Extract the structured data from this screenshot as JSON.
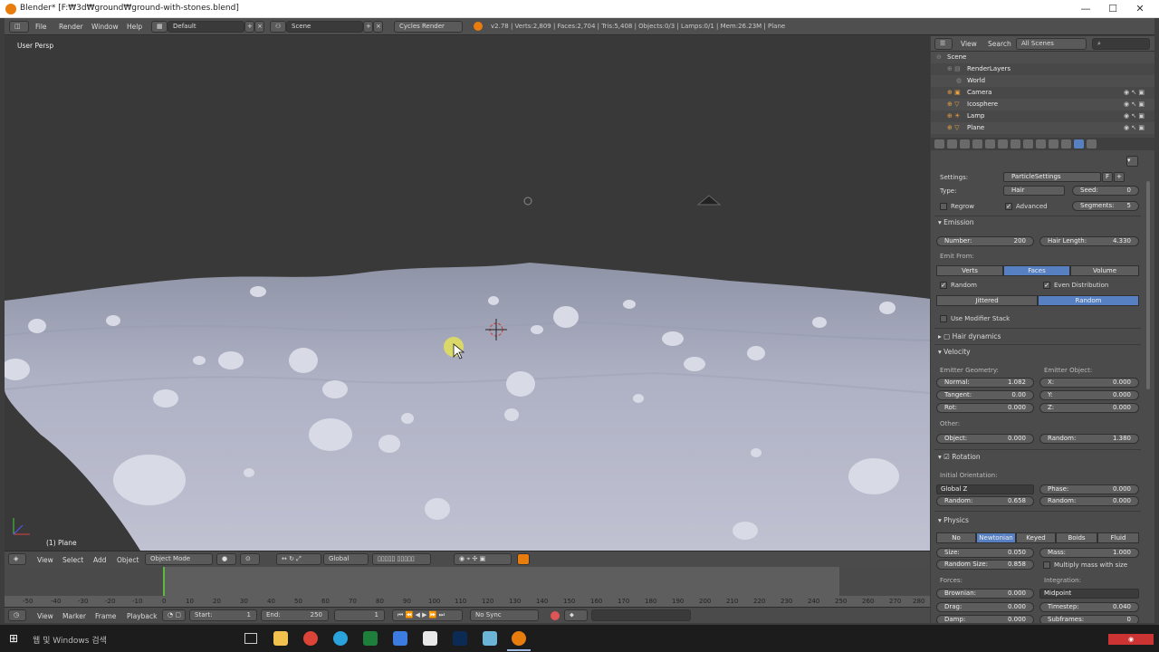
{
  "window": {
    "title": "Blender* [F:₩3d₩ground₩ground-with-stones.blend]",
    "min": "—",
    "max": "☐",
    "close": "✕"
  },
  "menubar": {
    "menus": [
      "File",
      "Render",
      "Window",
      "Help"
    ],
    "layout": "Default",
    "scene": "Scene",
    "engine": "Cycles Render",
    "stats": "v2.78 | Verts:2,809 | Faces:2,704 | Tris:5,408 | Objects:0/3 | Lamps:0/1 | Mem:26.23M | Plane"
  },
  "viewport": {
    "persp_label": "User Persp",
    "object_label": "(1) Plane",
    "header": {
      "menus": [
        "View",
        "Select",
        "Add",
        "Object"
      ],
      "mode": "Object Mode",
      "orientation": "Global"
    }
  },
  "timeline": {
    "ticks": [
      "-50",
      "-40",
      "-30",
      "-20",
      "-10",
      "0",
      "10",
      "20",
      "30",
      "40",
      "50",
      "60",
      "70",
      "80",
      "90",
      "100",
      "110",
      "120",
      "130",
      "140",
      "150",
      "160",
      "170",
      "180",
      "190",
      "200",
      "210",
      "220",
      "230",
      "240",
      "250",
      "260",
      "270",
      "280"
    ],
    "menus": [
      "View",
      "Marker",
      "Frame",
      "Playback"
    ],
    "start_label": "Start:",
    "start": "1",
    "end_label": "End:",
    "end": "250",
    "current": "1",
    "sync": "No Sync"
  },
  "outliner": {
    "view": "View",
    "search": "Search",
    "filter": "All Scenes",
    "items": [
      "Scene",
      "RenderLayers",
      "World",
      "Camera",
      "Icosphere",
      "Lamp",
      "Plane"
    ]
  },
  "props": {
    "settings_label": "Settings:",
    "settings_value": "ParticleSettings",
    "settings_f": "F",
    "type_label": "Type:",
    "type_value": "Hair",
    "seed_label": "Seed:",
    "seed_value": "0",
    "regrow": "Regrow",
    "advanced": "Advanced",
    "segments_label": "Segments:",
    "segments_value": "5",
    "emission": {
      "title": "Emission",
      "number_label": "Number:",
      "number_value": "200",
      "hair_length_label": "Hair Length:",
      "hair_length_value": "4.330",
      "emit_from": "Emit From:",
      "tabs": [
        "Verts",
        "Faces",
        "Volume"
      ],
      "random": "Random",
      "even": "Even Distribution",
      "dist_tabs": [
        "Jittered",
        "Random"
      ],
      "modifier_stack": "Use Modifier Stack"
    },
    "hair_dynamics": "Hair dynamics",
    "velocity": {
      "title": "Velocity",
      "emitter_geometry": "Emitter Geometry:",
      "emitter_object": "Emitter Object:",
      "normal_label": "Normal:",
      "normal_value": "1.082",
      "tangent_label": "Tangent:",
      "tangent_value": "0.00",
      "rot_label": "Rot:",
      "rot_value": "0.000",
      "x_label": "X:",
      "x_value": "0.000",
      "y_label": "Y:",
      "y_value": "0.000",
      "z_label": "Z:",
      "z_value": "0.000",
      "other": "Other:",
      "object_label": "Object:",
      "object_value": "0.000",
      "random_label": "Random:",
      "random_value": "1.380"
    },
    "rotation": {
      "title": "Rotation",
      "initial": "Initial Orientation:",
      "orient": "Global Z",
      "random_label": "Random:",
      "random_value": "0.658",
      "phase_label": "Phase:",
      "phase_value": "0.000",
      "random2_label": "Random:",
      "random2_value": "0.000"
    },
    "physics": {
      "title": "Physics",
      "tabs": [
        "No",
        "Newtonian",
        "Keyed",
        "Boids",
        "Fluid"
      ],
      "size_label": "Size:",
      "size_value": "0.050",
      "mass_label": "Mass:",
      "mass_value": "1.000",
      "random_size_label": "Random Size:",
      "random_size_value": "0.858",
      "multiply_mass": "Multiply mass with size",
      "forces": "Forces:",
      "integration": "Integration:",
      "brownian_label": "Brownian:",
      "brownian_value": "0.000",
      "integrator": "Midpoint",
      "drag_label": "Drag:",
      "drag_value": "0.000",
      "timestep_label": "Timestep:",
      "timestep_value": "0.040",
      "damp_label": "Damp:",
      "damp_value": "0.000",
      "subframes_label": "Subframes:",
      "subframes_value": "0"
    }
  },
  "taskbar": {
    "search": "여기에 입력하여 검색",
    "search_text": "웹 및 Windows 검색"
  },
  "accent": "#5680c2"
}
